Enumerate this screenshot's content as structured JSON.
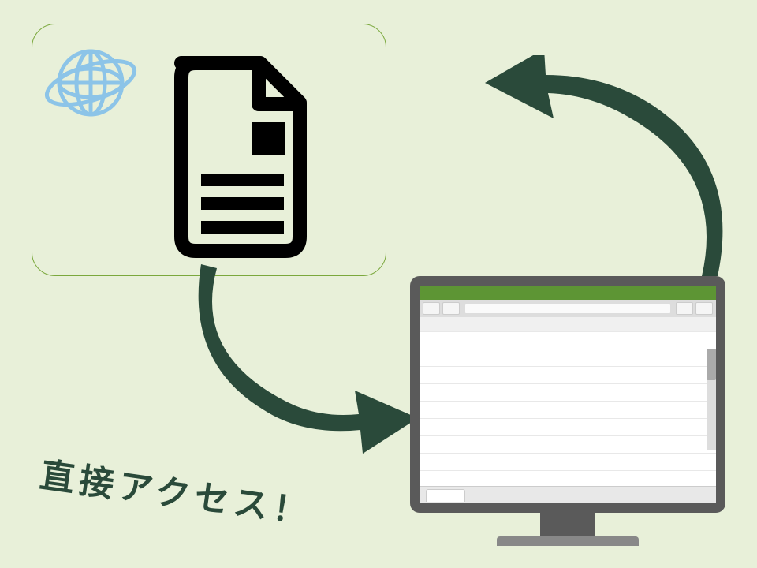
{
  "caption": "直接アクセス！",
  "colors": {
    "background": "#e8f0d9",
    "accent": "#2a4a3a",
    "globe": "#8cc4e8",
    "spreadsheet_header": "#5d9534"
  },
  "diagram": {
    "elements": [
      {
        "id": "web-document-box",
        "contains": [
          "globe-icon",
          "document-icon"
        ]
      },
      {
        "id": "computer-spreadsheet"
      },
      {
        "id": "arrow-document-to-computer",
        "direction": "down-right"
      },
      {
        "id": "arrow-computer-to-document",
        "direction": "up-left"
      }
    ]
  }
}
